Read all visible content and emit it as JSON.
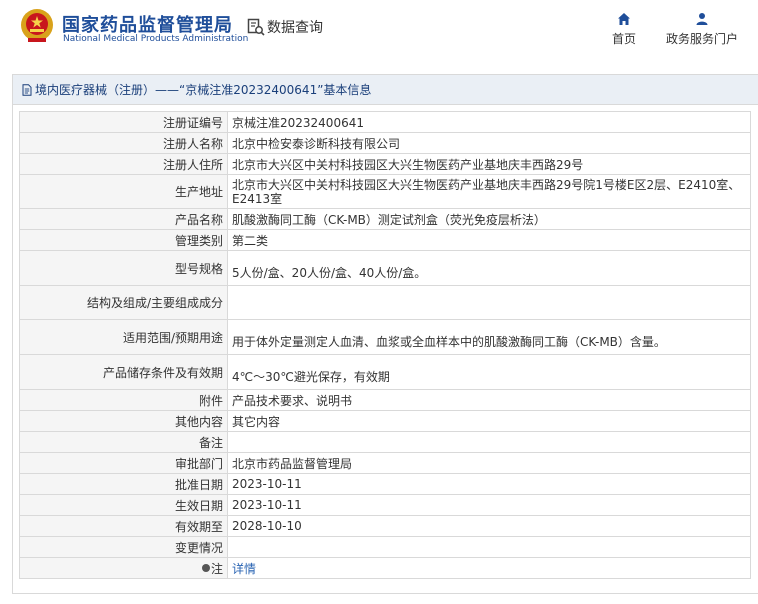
{
  "header": {
    "site_title": "国家药品监督管理局",
    "site_subtitle": "National Medical Products Administration",
    "data_query": "数据查询",
    "nav": [
      {
        "label": "首页",
        "icon": "home-icon"
      },
      {
        "label": "政务服务门户",
        "icon": "user-icon"
      }
    ],
    "accent_color": "#1f4e9a"
  },
  "panel": {
    "title": "境内医疗器械（注册）——“京械注准20232400641”基本信息"
  },
  "rows": [
    {
      "label": "注册证编号",
      "value": "京械注准20232400641"
    },
    {
      "label": "注册人名称",
      "value": "北京中检安泰诊断科技有限公司"
    },
    {
      "label": "注册人住所",
      "value": "北京市大兴区中关村科技园区大兴生物医药产业基地庆丰西路29号"
    },
    {
      "label": "生产地址",
      "value": "北京市大兴区中关村科技园区大兴生物医药产业基地庆丰西路29号院1号楼E区2层、E2410室、E2413室"
    },
    {
      "label": "产品名称",
      "value": "肌酸激酶同工酶（CK-MB）测定试剂盒（荧光免疫层析法）"
    },
    {
      "label": "管理类别",
      "value": "第二类"
    },
    {
      "label": "型号规格",
      "value": "5人份/盒、20人份/盒、40人份/盒。"
    },
    {
      "label": "结构及组成/主要组成成分",
      "value": ""
    },
    {
      "label": "适用范围/预期用途",
      "value": "用于体外定量测定人血清、血浆或全血样本中的肌酸激酶同工酶（CK-MB）含量。"
    },
    {
      "label": "产品储存条件及有效期",
      "value": "4℃～30℃避光保存，有效期"
    },
    {
      "label": "附件",
      "value": "产品技术要求、说明书"
    },
    {
      "label": "其他内容",
      "value": "其它内容"
    },
    {
      "label": "备注",
      "value": ""
    },
    {
      "label": "审批部门",
      "value": "北京市药品监督管理局"
    },
    {
      "label": "批准日期",
      "value": "2023-10-11"
    },
    {
      "label": "生效日期",
      "value": "2023-10-11"
    },
    {
      "label": "有效期至",
      "value": "2028-10-10"
    },
    {
      "label": "变更情况",
      "value": ""
    },
    {
      "label": "注",
      "value": "详情"
    }
  ]
}
